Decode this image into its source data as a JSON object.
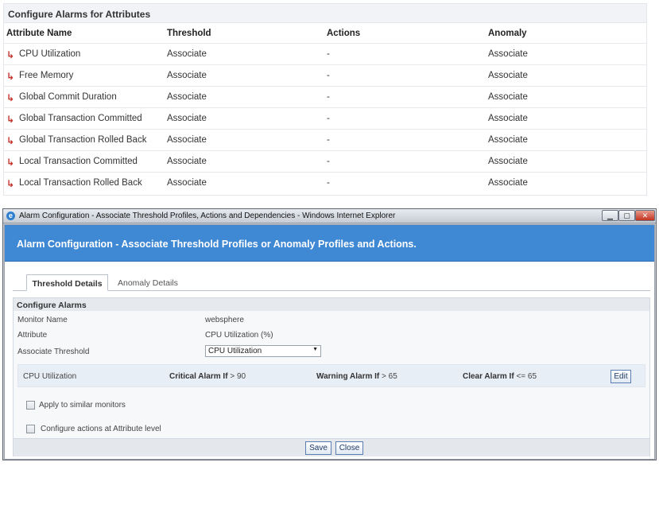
{
  "top_panel": {
    "title": "Configure Alarms for Attributes",
    "columns": [
      "Attribute Name",
      "Threshold",
      "Actions",
      "Anomaly"
    ],
    "row_arrow": "↳",
    "rows": [
      {
        "name": "CPU Utilization",
        "threshold": "Associate",
        "actions": "-",
        "anomaly": "Associate"
      },
      {
        "name": "Free Memory",
        "threshold": "Associate",
        "actions": "-",
        "anomaly": "Associate"
      },
      {
        "name": "Global Commit Duration",
        "threshold": "Associate",
        "actions": "-",
        "anomaly": "Associate"
      },
      {
        "name": "Global Transaction Committed",
        "threshold": "Associate",
        "actions": "-",
        "anomaly": "Associate"
      },
      {
        "name": "Global Transaction Rolled Back",
        "threshold": "Associate",
        "actions": "-",
        "anomaly": "Associate"
      },
      {
        "name": "Local Transaction Committed",
        "threshold": "Associate",
        "actions": "-",
        "anomaly": "Associate"
      },
      {
        "name": "Local Transaction Rolled Back",
        "threshold": "Associate",
        "actions": "-",
        "anomaly": "Associate"
      }
    ]
  },
  "window": {
    "title": "Alarm Configuration - Associate Threshold Profiles, Actions and Dependencies - Windows Internet Explorer",
    "icon": "ie-icon",
    "controls": {
      "minimize": "▁",
      "maximize": "▢",
      "close": "✕"
    },
    "banner": "Alarm Configuration - Associate Threshold Profiles or Anomaly Profiles and Actions.",
    "tabs": {
      "threshold": "Threshold Details",
      "anomaly": "Anomaly Details"
    },
    "config": {
      "title": "Configure Alarms",
      "monitor_label": "Monitor Name",
      "monitor_value": "websphere",
      "attribute_label": "Attribute",
      "attribute_value": "CPU Utilization (%)",
      "threshold_label": "Associate Threshold",
      "threshold_selected": "CPU Utilization",
      "threshold_row": {
        "name": "CPU Utilization",
        "critical_label": "Critical Alarm If",
        "critical_value": "> 90",
        "warning_label": "Warning Alarm If",
        "warning_value": "> 65",
        "clear_label": "Clear Alarm If",
        "clear_value": "<= 65",
        "edit": "Edit"
      },
      "apply_similar": "Apply to similar monitors",
      "configure_actions": "Configure actions at Attribute level",
      "save": "Save",
      "close": "Close"
    }
  },
  "colors": {
    "banner": "#3f88d4",
    "arrow": "#c5322b"
  }
}
